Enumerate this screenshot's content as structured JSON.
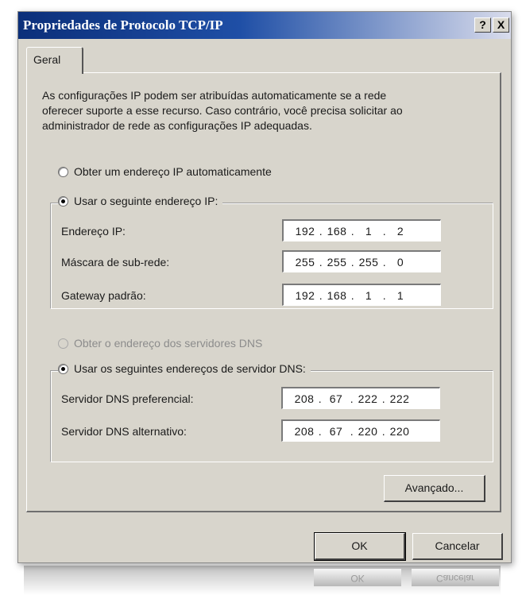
{
  "window": {
    "title": "Propriedades de Protocolo TCP/IP",
    "help_button": "?",
    "close_button": "X"
  },
  "tabs": [
    {
      "label": "Geral",
      "active": true
    }
  ],
  "description": "As configurações IP podem ser atribuídas automaticamente se a rede\noferecer suporte a esse recurso. Caso contrário, você precisa solicitar ao\nadministrador de rede as configurações IP adequadas.",
  "ip_options": {
    "auto_label": "Obter um endereço IP automaticamente",
    "manual_label": "Usar o seguinte endereço IP:",
    "selected": "manual"
  },
  "ip_fields": [
    {
      "label": "Endereço IP:",
      "value": [
        "192",
        "168",
        "1",
        "2"
      ]
    },
    {
      "label": "Máscara de sub-rede:",
      "value": [
        "255",
        "255",
        "255",
        "0"
      ]
    },
    {
      "label": "Gateway padrão:",
      "value": [
        "192",
        "168",
        "1",
        "1"
      ]
    }
  ],
  "dns_options": {
    "auto_label": "Obter o endereço dos servidores DNS",
    "auto_disabled": true,
    "manual_label": "Usar os seguintes endereços de servidor DNS:",
    "selected": "manual"
  },
  "dns_fields": [
    {
      "label": "Servidor DNS preferencial:",
      "value": [
        "208",
        "67",
        "222",
        "222"
      ]
    },
    {
      "label": "Servidor DNS alternativo:",
      "value": [
        "208",
        "67",
        "220",
        "220"
      ]
    }
  ],
  "buttons": {
    "advanced": "Avançado...",
    "ok": "OK",
    "cancel": "Cancelar"
  },
  "colors": {
    "dialog_bg": "#d8d5cc",
    "title_gradient_start": "#0b2f7a",
    "title_gradient_end": "#d9dcec"
  }
}
